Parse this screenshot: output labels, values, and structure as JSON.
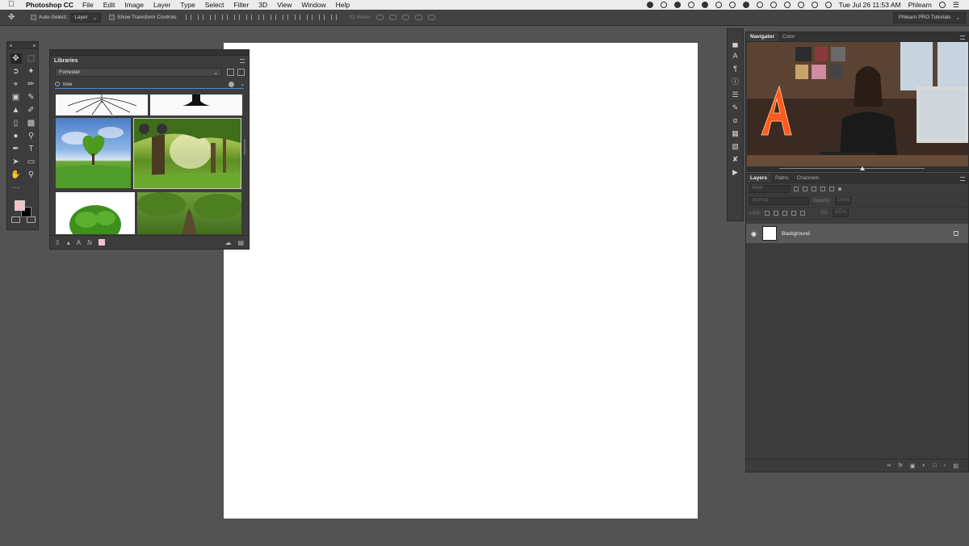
{
  "menubar": {
    "app_name": "Photoshop CC",
    "items": [
      "File",
      "Edit",
      "Image",
      "Layer",
      "Type",
      "Select",
      "Filter",
      "3D",
      "View",
      "Window",
      "Help"
    ],
    "clock": "Tue Jul 26  11:53 AM",
    "user": "Phlearn"
  },
  "options": {
    "auto_select_label": "Auto-Select:",
    "auto_select_target": "Layer",
    "transform_label": "Show Transform Controls",
    "mode3d_label": "3D Mode:",
    "workspace": "Phlearn PRO Tutorials"
  },
  "toolbox": {
    "foreground_color": "#f2c2cc",
    "background_color": "#000000",
    "tools": [
      "move-icon",
      "marquee-icon",
      "lasso-icon",
      "magic-wand-icon",
      "crop-icon",
      "eyedropper-icon",
      "healing-icon",
      "brush-icon",
      "clone-stamp-icon",
      "history-brush-icon",
      "eraser-icon",
      "gradient-icon",
      "blur-icon",
      "dodge-icon",
      "pen-icon",
      "type-icon",
      "path-select-icon",
      "shape-icon",
      "hand-icon",
      "zoom-icon",
      "more-icon"
    ]
  },
  "libraries": {
    "title": "Libraries",
    "library_name": "Forrester",
    "search_value": "tree"
  },
  "navigator": {
    "tabs": [
      "Navigator",
      "Color"
    ],
    "active_tab": "Navigator"
  },
  "layers": {
    "tabs": [
      "Layers",
      "Paths",
      "Channels"
    ],
    "active_tab": "Layers",
    "kind_placeholder": "Kind",
    "blend_mode": "Normal",
    "opacity_label": "Opacity:",
    "opacity_value": "100%",
    "lock_label": "Lock:",
    "fill_label": "Fill:",
    "fill_value": "100%",
    "items": [
      {
        "name": "Background",
        "visible": true,
        "locked": true
      }
    ]
  },
  "colors": {
    "accent": "#4c8ad9",
    "panel": "#3c3c3c",
    "workspace_bg": "#535353"
  }
}
